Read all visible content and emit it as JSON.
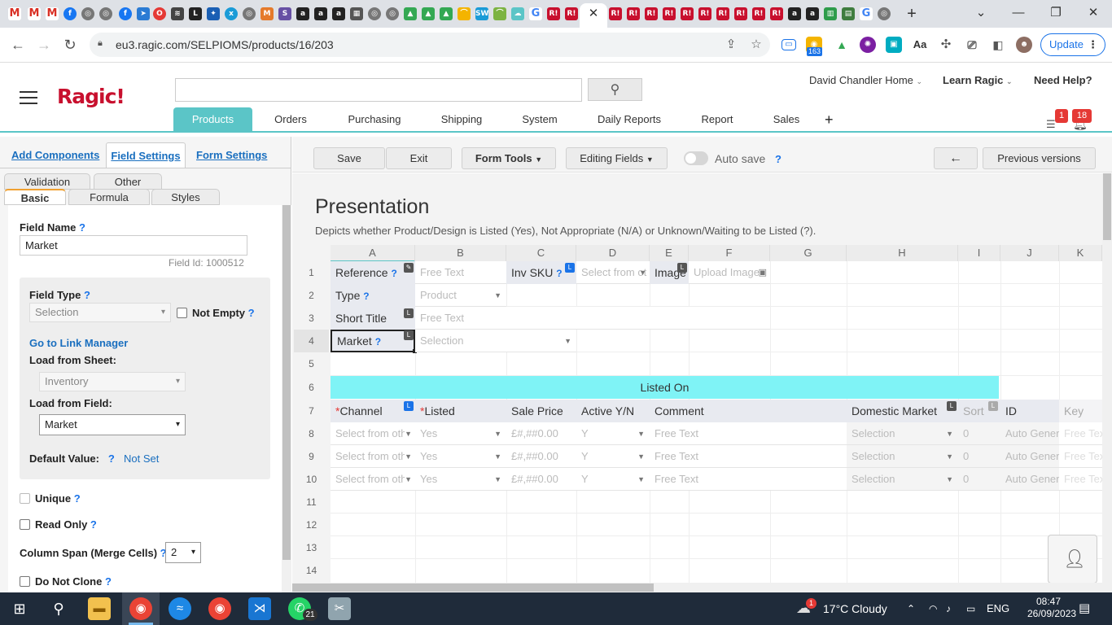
{
  "browser": {
    "tab_close": "✕",
    "new_tab": "+",
    "window_controls": {
      "minimize": "—",
      "maximize": "❐",
      "close": "✕",
      "dropdown": "⌄"
    },
    "url": "eu3.ragic.com/SELPIOMS/products/16/203",
    "update_label": "Update",
    "ext_badge": "163"
  },
  "app": {
    "logo": "Ragic!",
    "search_button_icon": "search-icon",
    "user_menu": "David Chandler Home",
    "learn_menu": "Learn Ragic",
    "help_menu": "Need Help?",
    "tabs": [
      "Products",
      "Orders",
      "Purchasing",
      "Shipping",
      "System",
      "Daily Reports",
      "Report",
      "Sales"
    ],
    "add_tab": "+",
    "notif_count_1": "1",
    "notif_count_2": "18"
  },
  "left_panel": {
    "tabs": {
      "add_components": "Add Components",
      "field_settings": "Field Settings",
      "form_settings": "Form Settings"
    },
    "subtabs": {
      "validation": "Validation",
      "other": "Other",
      "basic": "Basic",
      "formula": "Formula",
      "styles": "Styles"
    },
    "field_name_label": "Field Name",
    "field_name_value": "Market",
    "field_id": "Field Id: 1000512",
    "field_type_label": "Field Type",
    "field_type_value": "Selection",
    "not_empty_label": "Not Empty",
    "link_manager": "Go to Link Manager",
    "load_sheet_label": "Load from Sheet:",
    "load_sheet_value": "Inventory",
    "load_field_label": "Load from Field:",
    "load_field_value": "Market",
    "default_value_label": "Default Value:",
    "default_value_link": "Not Set",
    "unique_label": "Unique",
    "read_only_label": "Read Only",
    "column_span_label": "Column Span (Merge Cells)",
    "column_span_value": "2",
    "do_not_clone_label": "Do Not Clone",
    "help_mark": "?"
  },
  "form_toolbar": {
    "save": "Save",
    "exit": "Exit",
    "form_tools": "Form Tools",
    "editing_fields": "Editing Fields",
    "auto_save": "Auto save",
    "back_arrow": "←",
    "previous_versions": "Previous versions"
  },
  "form": {
    "title": "Presentation",
    "description": "Depicts whether Product/Design is Listed (Yes), Not Appropriate (N/A) or Unknown/Waiting to be Listed (?).",
    "columns": [
      "A",
      "B",
      "C",
      "D",
      "E",
      "F",
      "G",
      "H",
      "I",
      "J",
      "K"
    ],
    "rows": [
      "1",
      "2",
      "3",
      "4",
      "5",
      "6",
      "7",
      "8",
      "9",
      "10",
      "11",
      "12",
      "13",
      "14"
    ],
    "fields": {
      "reference": "Reference",
      "reference_value": "Free Text",
      "inv_sku": "Inv SKU",
      "inv_sku_value": "Select from ot",
      "image": "Image",
      "image_value": "Upload Image",
      "type": "Type",
      "type_value": "Product",
      "short_title": "Short Title",
      "short_title_value": "Free Text",
      "market": "Market",
      "market_value": "Selection"
    },
    "section_title": "Listed On",
    "subtable": {
      "headers": {
        "channel": "Channel",
        "listed": "Listed",
        "sale_price": "Sale Price",
        "active": "Active Y/N",
        "comment": "Comment",
        "domestic_market": "Domestic Market",
        "sort": "Sort",
        "id": "ID",
        "key": "Key"
      },
      "required_mark": "*",
      "row_values": {
        "channel": "Select from othe",
        "listed": "Yes",
        "sale_price": "£#,##0.00",
        "active": "Y",
        "comment": "Free Text",
        "domestic_market": "Selection",
        "sort": "0",
        "id": "Auto Gener",
        "key": "Free Tex"
      }
    }
  },
  "taskbar": {
    "weather": "17°C  Cloudy",
    "language": "ENG",
    "time": "08:47",
    "date": "26/09/2023",
    "whatsapp_badge": "21",
    "weather_badge": "1"
  }
}
